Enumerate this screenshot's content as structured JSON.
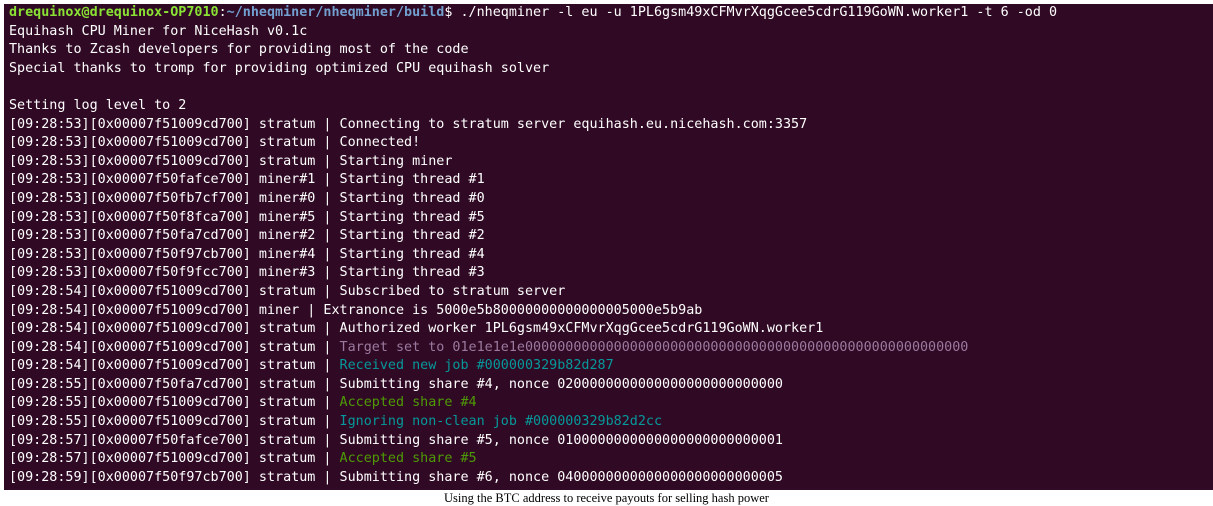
{
  "prompt": {
    "user_host": "drequinox@drequinox-OP7010",
    "path": "~/nheqminer/nheqminer/build",
    "symbol": "$ ",
    "command": "./nheqminer -l eu -u 1PL6gsm49xCFMvrXqgGcee5cdrG119GoWN.worker1 -t 6 -od 0"
  },
  "banner": [
    "Equihash CPU Miner for NiceHash v0.1c",
    "Thanks to Zcash developers for providing most of the code",
    "Special thanks to tromp for providing optimized CPU equihash solver"
  ],
  "blank": "",
  "log_level": "Setting log level to 2",
  "log": [
    {
      "prefix": "[09:28:53][0x00007f51009cd700] stratum | ",
      "msg": "Connecting to stratum server equihash.eu.nicehash.com:3357",
      "color": "default"
    },
    {
      "prefix": "[09:28:53][0x00007f51009cd700] stratum | ",
      "msg": "Connected!",
      "color": "default"
    },
    {
      "prefix": "[09:28:53][0x00007f51009cd700] stratum | ",
      "msg": "Starting miner",
      "color": "default"
    },
    {
      "prefix": "[09:28:53][0x00007f50fafce700] miner#1 | ",
      "msg": "Starting thread #1",
      "color": "default"
    },
    {
      "prefix": "[09:28:53][0x00007f50fb7cf700] miner#0 | ",
      "msg": "Starting thread #0",
      "color": "default"
    },
    {
      "prefix": "[09:28:53][0x00007f50f8fca700] miner#5 | ",
      "msg": "Starting thread #5",
      "color": "default"
    },
    {
      "prefix": "[09:28:53][0x00007f50fa7cd700] miner#2 | ",
      "msg": "Starting thread #2",
      "color": "default"
    },
    {
      "prefix": "[09:28:53][0x00007f50f97cb700] miner#4 | ",
      "msg": "Starting thread #4",
      "color": "default"
    },
    {
      "prefix": "[09:28:53][0x00007f50f9fcc700] miner#3 | ",
      "msg": "Starting thread #3",
      "color": "default"
    },
    {
      "prefix": "[09:28:54][0x00007f51009cd700] stratum | ",
      "msg": "Subscribed to stratum server",
      "color": "default"
    },
    {
      "prefix": "[09:28:54][0x00007f51009cd700] miner | ",
      "msg": "Extranonce is 5000e5b80000000000000005000e5b9ab",
      "color": "default"
    },
    {
      "prefix": "[09:28:54][0x00007f51009cd700] stratum | ",
      "msg": "Authorized worker 1PL6gsm49xCFMvrXqgGcee5cdrG119GoWN.worker1",
      "color": "default"
    },
    {
      "prefix": "[09:28:54][0x00007f51009cd700] stratum | ",
      "msg": "Target set to 01e1e1e1e0000000000000000000000000000000000000000000000000000000",
      "color": "target"
    },
    {
      "prefix": "[09:28:54][0x00007f51009cd700] stratum | ",
      "msg": "Received new job #000000329b82d287",
      "color": "cyan"
    },
    {
      "prefix": "[09:28:55][0x00007f50fa7cd700] stratum | ",
      "msg": "Submitting share #4, nonce 0200000000000000000000000000",
      "color": "default"
    },
    {
      "prefix": "[09:28:55][0x00007f51009cd700] stratum | ",
      "msg": "Accepted share #4",
      "color": "green"
    },
    {
      "prefix": "[09:28:55][0x00007f51009cd700] stratum | ",
      "msg": "Ignoring non-clean job #000000329b82d2cc",
      "color": "cyan"
    },
    {
      "prefix": "[09:28:57][0x00007f50fafce700] stratum | ",
      "msg": "Submitting share #5, nonce 0100000000000000000000000001",
      "color": "default"
    },
    {
      "prefix": "[09:28:57][0x00007f51009cd700] stratum | ",
      "msg": "Accepted share #5",
      "color": "green"
    },
    {
      "prefix": "[09:28:59][0x00007f50f97cb700] stratum | ",
      "msg": "Submitting share #6, nonce 0400000000000000000000000005",
      "color": "default"
    }
  ],
  "caption": "Using the BTC address to receive payouts for selling hash power",
  "colors": {
    "background": "#300a24",
    "prompt_user": "#8ae234",
    "prompt_path": "#729fcf",
    "target": "#9b7a9f",
    "cyan": "#06989a",
    "green": "#4e9a06"
  }
}
